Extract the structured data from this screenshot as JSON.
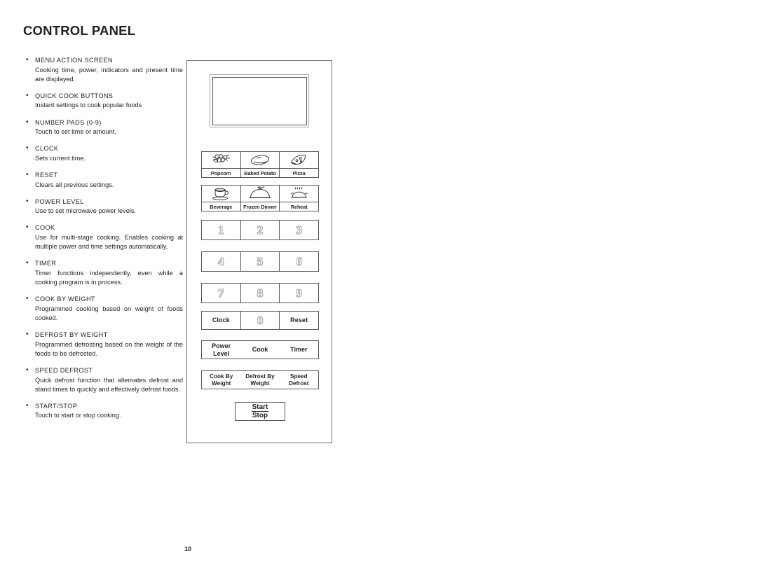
{
  "page": {
    "title": "CONTROL PANEL",
    "number": "10"
  },
  "descriptions": [
    {
      "heading": "MENU ACTION SCREEN",
      "body": "Cooking time, power, indicators and present time are displayed."
    },
    {
      "heading": "QUICK COOK BUTTONS",
      "body": "Instant settings to cook popular foods"
    },
    {
      "heading": "NUMBER PADS (0-9)",
      "body": "Touch to set time or amount."
    },
    {
      "heading": "CLOCK",
      "body": "Sets current time."
    },
    {
      "heading": "RESET",
      "body": "Clears all previous settings."
    },
    {
      "heading": "POWER LEVEL",
      "body": "Use to set microwave power levels."
    },
    {
      "heading": "COOK",
      "body": "Use for multi-stage cooking. Enables cooking at multiple power and time settings automatically."
    },
    {
      "heading": "TIMER",
      "body": "Timer functions independently, even while a cooking program is in process."
    },
    {
      "heading": "COOK BY WEIGHT",
      "body": "Programmed cooking based on weight of foods cooked."
    },
    {
      "heading": "DEFROST BY WEIGHT",
      "body": "Programmed defrosting based on the weight of the foods to be defrosted."
    },
    {
      "heading": "SPEED DEFROST",
      "body": "Quick defrost function that alternates defrost and stand times to quickly and effectively defrost foods."
    },
    {
      "heading": "START/STOP",
      "body": "Touch to start or stop cooking."
    }
  ],
  "control_panel": {
    "display": {
      "label": "menu action screen display",
      "content": ""
    },
    "quick_cook_row_1": [
      {
        "label": "Popcorn",
        "icon": "popcorn-icon"
      },
      {
        "label": "Baked Potato",
        "icon": "baked-potato-icon"
      },
      {
        "label": "Pizza",
        "icon": "pizza-slice-icon"
      }
    ],
    "quick_cook_row_2": [
      {
        "label": "Beverage",
        "icon": "coffee-cup-icon"
      },
      {
        "label": "Frozen Dinner",
        "icon": "covered-dish-icon"
      },
      {
        "label": "Reheat",
        "icon": "steaming-pot-icon"
      }
    ],
    "number_rows": [
      [
        "1",
        "2",
        "3"
      ],
      [
        "4",
        "5",
        "6"
      ],
      [
        "7",
        "8",
        "9"
      ]
    ],
    "clock_row": [
      "Clock",
      "0",
      "Reset"
    ],
    "function_row": [
      {
        "line1": "Power",
        "line2": "Level"
      },
      {
        "line1": "Cook",
        "line2": ""
      },
      {
        "line1": "Timer",
        "line2": ""
      }
    ],
    "weight_row": [
      {
        "line1": "Cook By",
        "line2": "Weight"
      },
      {
        "line1": "Defrost By",
        "line2": "Weight"
      },
      {
        "line1": "Speed",
        "line2": "Defrost"
      }
    ],
    "start_stop": {
      "start": "Start",
      "stop": "Stop"
    }
  },
  "colors": {
    "ink": "#231f20",
    "panel_border": "#6d6e71",
    "button_border": "#58595b",
    "number_outline": "#a7a9ac"
  }
}
